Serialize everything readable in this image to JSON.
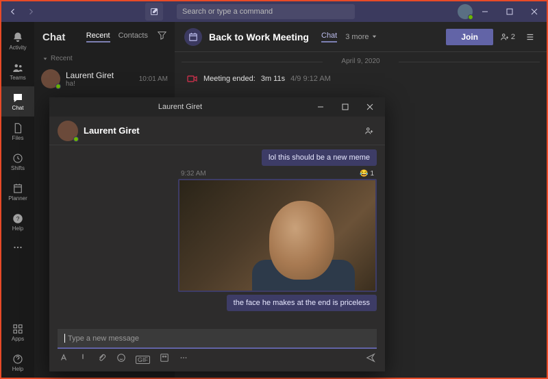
{
  "window": {
    "search_placeholder": "Search or type a command"
  },
  "rail": {
    "items": [
      {
        "label": "Activity"
      },
      {
        "label": "Teams"
      },
      {
        "label": "Chat"
      },
      {
        "label": "Files"
      },
      {
        "label": "Shifts"
      },
      {
        "label": "Planner"
      },
      {
        "label": "Help"
      }
    ],
    "bottom": [
      {
        "label": "Apps"
      },
      {
        "label": "Help"
      }
    ]
  },
  "list": {
    "title": "Chat",
    "tabs": [
      "Recent",
      "Contacts"
    ],
    "group": "Recent",
    "items": [
      {
        "name": "Laurent Giret",
        "preview": "ha!",
        "time": "10:01 AM"
      }
    ]
  },
  "main": {
    "title": "Back to Work Meeting",
    "tabs": {
      "chat": "Chat",
      "more": "3 more"
    },
    "join": "Join",
    "participant_count": "2",
    "date": "April 9, 2020",
    "meeting_ended": {
      "label": "Meeting ended:",
      "duration": "3m 11s",
      "time": "4/9 9:12 AM"
    }
  },
  "popout": {
    "titlebar": "Laurent Giret",
    "header_name": "Laurent Giret",
    "messages": {
      "prev": "lol this should be a new meme",
      "time": "9:32 AM",
      "reaction_count": "1",
      "caption": "the face he makes at the end is priceless"
    },
    "compose_placeholder": "Type a new message"
  }
}
